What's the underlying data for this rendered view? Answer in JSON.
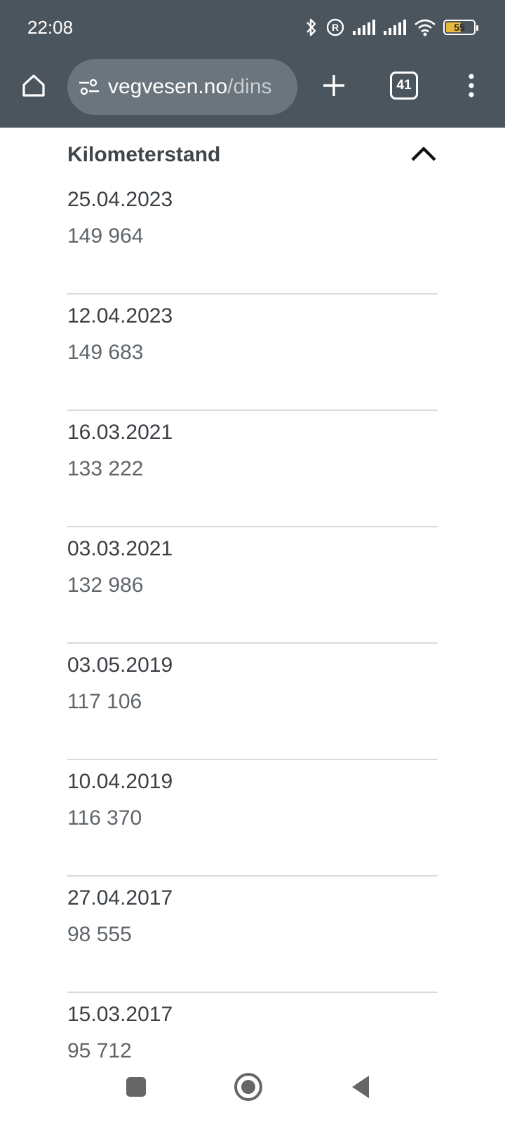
{
  "status_bar": {
    "time": "22:08",
    "battery_level": "55",
    "icons": [
      "bluetooth-icon",
      "registered-icon",
      "signal-icon",
      "signal-icon",
      "wifi-icon",
      "battery-icon"
    ]
  },
  "browser": {
    "url_domain": "vegvesen.no",
    "url_path": "/dins",
    "tab_count": "41",
    "icons": [
      "home-icon",
      "site-settings-icon",
      "plus-icon",
      "more-vert-icon"
    ]
  },
  "section": {
    "title": "Kilometerstand",
    "expanded": true
  },
  "entries": [
    {
      "date": "25.04.2023",
      "km": "149 964"
    },
    {
      "date": "12.04.2023",
      "km": "149 683"
    },
    {
      "date": "16.03.2021",
      "km": "133 222"
    },
    {
      "date": "03.03.2021",
      "km": "132 986"
    },
    {
      "date": "03.05.2019",
      "km": "117 106"
    },
    {
      "date": "10.04.2019",
      "km": "116 370"
    },
    {
      "date": "27.04.2017",
      "km": "98 555"
    },
    {
      "date": "15.03.2017",
      "km": "95 712"
    }
  ],
  "nav_bar": {
    "icons": [
      "recents-icon",
      "home-circle-icon",
      "back-icon"
    ]
  },
  "colors": {
    "chrome": "#4b555d",
    "url_bar": "#6b757d",
    "battery_fill": "#e8b93b",
    "divider": "#d9d9d9"
  }
}
